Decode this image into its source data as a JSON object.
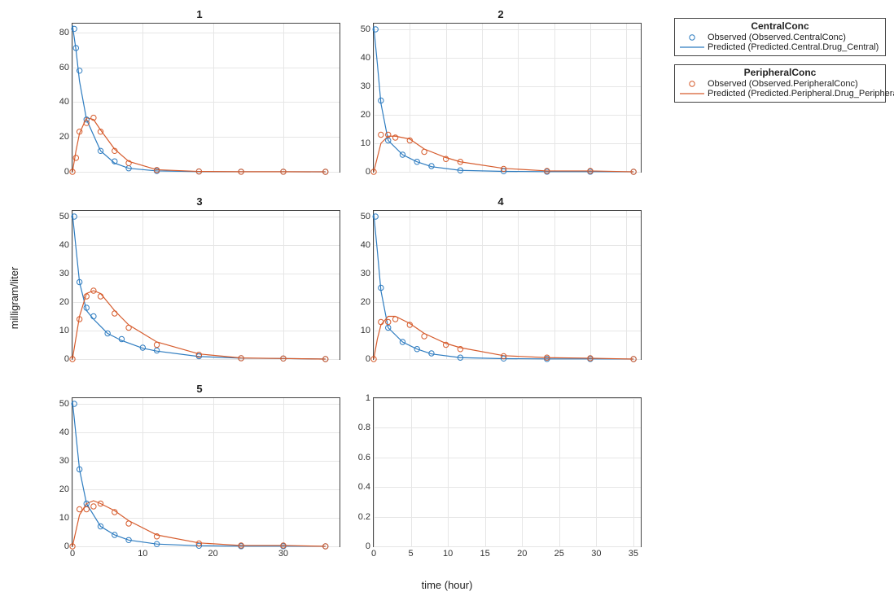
{
  "axis_labels": {
    "x": "time (hour)",
    "y": "milligram/liter"
  },
  "legend": {
    "central": {
      "title": "CentralConc",
      "observed": "Observed (Observed.CentralConc)",
      "predicted": "Predicted (Predicted.Central.Drug_Central)"
    },
    "peripheral": {
      "title": "PeripheralConc",
      "observed": "Observed (Observed.PeripheralConc)",
      "predicted": "Predicted (Predicted.Peripheral.Drug_Peripheral)"
    }
  },
  "chart_data": [
    {
      "title": "1",
      "xticks": [
        0,
        10,
        20,
        30
      ],
      "xmax": 38,
      "yticks": [
        0,
        20,
        40,
        60,
        80
      ],
      "ymax": 85,
      "central_obs": [
        [
          0.25,
          82
        ],
        [
          0.5,
          71
        ],
        [
          1,
          58
        ],
        [
          2,
          30
        ],
        [
          4,
          12
        ],
        [
          6,
          6
        ],
        [
          8,
          2
        ],
        [
          12,
          0.5
        ],
        [
          18,
          0.2
        ],
        [
          24,
          0.05
        ],
        [
          30,
          0.05
        ],
        [
          36,
          0
        ]
      ],
      "peripheral_obs": [
        [
          0,
          0
        ],
        [
          0.5,
          8
        ],
        [
          1,
          23
        ],
        [
          2,
          28
        ],
        [
          3,
          31
        ],
        [
          4,
          23
        ],
        [
          6,
          12
        ],
        [
          8,
          5
        ],
        [
          12,
          1
        ],
        [
          18,
          0.2
        ],
        [
          24,
          0.05
        ],
        [
          30,
          0.05
        ],
        [
          36,
          0
        ]
      ],
      "central_pred": [
        [
          0,
          84
        ],
        [
          0.5,
          70
        ],
        [
          1,
          52
        ],
        [
          2,
          30
        ],
        [
          4,
          12
        ],
        [
          6,
          5
        ],
        [
          8,
          2
        ],
        [
          12,
          0.5
        ],
        [
          18,
          0.1
        ],
        [
          24,
          0.03
        ],
        [
          30,
          0.02
        ],
        [
          36,
          0
        ]
      ],
      "peripheral_pred": [
        [
          0,
          0
        ],
        [
          0.5,
          12
        ],
        [
          1,
          22
        ],
        [
          2,
          31
        ],
        [
          3,
          30
        ],
        [
          4,
          24
        ],
        [
          6,
          13
        ],
        [
          8,
          6
        ],
        [
          12,
          1.2
        ],
        [
          18,
          0.2
        ],
        [
          24,
          0.05
        ],
        [
          30,
          0.05
        ],
        [
          36,
          0
        ]
      ]
    },
    {
      "title": "2",
      "xticks": [
        0,
        5,
        10,
        15,
        20,
        25,
        30,
        35
      ],
      "xmax": 37,
      "yticks": [
        0,
        10,
        20,
        30,
        40,
        50
      ],
      "ymax": 52,
      "central_obs": [
        [
          0.25,
          50
        ],
        [
          1,
          25
        ],
        [
          2,
          11
        ],
        [
          4,
          6
        ],
        [
          6,
          3.5
        ],
        [
          8,
          2
        ],
        [
          12,
          0.5
        ],
        [
          18,
          0.2
        ],
        [
          24,
          0.05
        ],
        [
          30,
          0.05
        ],
        [
          36,
          0
        ]
      ],
      "peripheral_obs": [
        [
          0,
          0
        ],
        [
          1,
          13
        ],
        [
          2,
          13
        ],
        [
          3,
          12
        ],
        [
          5,
          11
        ],
        [
          7,
          7
        ],
        [
          10,
          4.5
        ],
        [
          12,
          3.5
        ],
        [
          18,
          1
        ],
        [
          24,
          0.3
        ],
        [
          30,
          0.3
        ],
        [
          36,
          0
        ]
      ],
      "central_pred": [
        [
          0,
          51
        ],
        [
          0.5,
          38
        ],
        [
          1,
          24
        ],
        [
          2,
          11
        ],
        [
          4,
          6
        ],
        [
          6,
          3.5
        ],
        [
          8,
          1.8
        ],
        [
          12,
          0.5
        ],
        [
          18,
          0.15
        ],
        [
          24,
          0.05
        ],
        [
          30,
          0.05
        ],
        [
          36,
          0
        ]
      ],
      "peripheral_pred": [
        [
          0,
          0
        ],
        [
          0.5,
          5
        ],
        [
          1,
          10
        ],
        [
          2,
          12.5
        ],
        [
          3,
          12.5
        ],
        [
          5,
          11.5
        ],
        [
          7,
          8
        ],
        [
          10,
          5
        ],
        [
          12,
          3.5
        ],
        [
          18,
          1.2
        ],
        [
          24,
          0.3
        ],
        [
          30,
          0.3
        ],
        [
          36,
          0
        ]
      ]
    },
    {
      "title": "3",
      "xticks": [
        0,
        10,
        20,
        30
      ],
      "xmax": 38,
      "yticks": [
        0,
        10,
        20,
        30,
        40,
        50
      ],
      "ymax": 52,
      "central_obs": [
        [
          0.25,
          50
        ],
        [
          1,
          27
        ],
        [
          2,
          18
        ],
        [
          3,
          15
        ],
        [
          5,
          9
        ],
        [
          7,
          7
        ],
        [
          10,
          4
        ],
        [
          12,
          3
        ],
        [
          18,
          1
        ],
        [
          24,
          0.3
        ],
        [
          30,
          0.2
        ],
        [
          36,
          0
        ]
      ],
      "peripheral_obs": [
        [
          0,
          0
        ],
        [
          1,
          14
        ],
        [
          2,
          22
        ],
        [
          3,
          24
        ],
        [
          4,
          22
        ],
        [
          6,
          16
        ],
        [
          8,
          11
        ],
        [
          12,
          5
        ],
        [
          18,
          1.5
        ],
        [
          24,
          0.3
        ],
        [
          30,
          0.2
        ],
        [
          36,
          0
        ]
      ],
      "central_pred": [
        [
          0,
          51
        ],
        [
          1,
          27
        ],
        [
          2,
          17
        ],
        [
          3,
          14
        ],
        [
          5,
          9
        ],
        [
          7,
          6.5
        ],
        [
          10,
          3.8
        ],
        [
          12,
          2.8
        ],
        [
          18,
          0.9
        ],
        [
          24,
          0.3
        ],
        [
          30,
          0.2
        ],
        [
          36,
          0
        ]
      ],
      "peripheral_pred": [
        [
          0,
          0
        ],
        [
          1,
          15
        ],
        [
          2,
          23
        ],
        [
          3,
          24
        ],
        [
          4,
          23
        ],
        [
          6,
          17
        ],
        [
          8,
          12
        ],
        [
          12,
          6
        ],
        [
          18,
          1.8
        ],
        [
          24,
          0.4
        ],
        [
          30,
          0.2
        ],
        [
          36,
          0
        ]
      ]
    },
    {
      "title": "4",
      "xticks": [
        0,
        5,
        10,
        15,
        20,
        25,
        30,
        35
      ],
      "xmax": 37,
      "yticks": [
        0,
        10,
        20,
        30,
        40,
        50
      ],
      "ymax": 52,
      "central_obs": [
        [
          0.25,
          50
        ],
        [
          1,
          25
        ],
        [
          2,
          11
        ],
        [
          4,
          6
        ],
        [
          6,
          3.5
        ],
        [
          8,
          2
        ],
        [
          12,
          0.5
        ],
        [
          18,
          0.2
        ],
        [
          24,
          0.05
        ],
        [
          30,
          0.05
        ],
        [
          36,
          0
        ]
      ],
      "peripheral_obs": [
        [
          0,
          0
        ],
        [
          1,
          13
        ],
        [
          2,
          13
        ],
        [
          3,
          14
        ],
        [
          5,
          12
        ],
        [
          7,
          8
        ],
        [
          10,
          5
        ],
        [
          12,
          3.5
        ],
        [
          18,
          1
        ],
        [
          24,
          0.5
        ],
        [
          30,
          0.3
        ],
        [
          36,
          0
        ]
      ],
      "central_pred": [
        [
          0,
          51
        ],
        [
          0.5,
          38
        ],
        [
          1,
          24
        ],
        [
          2,
          11
        ],
        [
          4,
          6
        ],
        [
          6,
          3.5
        ],
        [
          8,
          1.8
        ],
        [
          12,
          0.5
        ],
        [
          18,
          0.15
        ],
        [
          24,
          0.05
        ],
        [
          30,
          0.05
        ],
        [
          36,
          0
        ]
      ],
      "peripheral_pred": [
        [
          0,
          0
        ],
        [
          0.5,
          7
        ],
        [
          1,
          12
        ],
        [
          2,
          15
        ],
        [
          3,
          15
        ],
        [
          5,
          12.5
        ],
        [
          7,
          9
        ],
        [
          10,
          5.5
        ],
        [
          12,
          4
        ],
        [
          18,
          1.2
        ],
        [
          24,
          0.5
        ],
        [
          30,
          0.3
        ],
        [
          36,
          0
        ]
      ]
    },
    {
      "title": "5",
      "xticks": [
        0,
        10,
        20,
        30
      ],
      "xmax": 38,
      "yticks": [
        0,
        10,
        20,
        30,
        40,
        50
      ],
      "ymax": 52,
      "central_obs": [
        [
          0.25,
          50
        ],
        [
          1,
          27
        ],
        [
          2,
          15
        ],
        [
          4,
          7
        ],
        [
          6,
          4
        ],
        [
          8,
          2.2
        ],
        [
          12,
          0.8
        ],
        [
          18,
          0.2
        ],
        [
          24,
          0.05
        ],
        [
          30,
          0.05
        ],
        [
          36,
          0
        ]
      ],
      "peripheral_obs": [
        [
          0,
          0
        ],
        [
          1,
          13
        ],
        [
          2,
          13
        ],
        [
          3,
          14
        ],
        [
          4,
          15
        ],
        [
          6,
          12
        ],
        [
          8,
          8
        ],
        [
          12,
          3.5
        ],
        [
          18,
          1
        ],
        [
          24,
          0.3
        ],
        [
          30,
          0.3
        ],
        [
          36,
          0
        ]
      ],
      "central_pred": [
        [
          0,
          51
        ],
        [
          1,
          27
        ],
        [
          2,
          15
        ],
        [
          4,
          7
        ],
        [
          6,
          4
        ],
        [
          8,
          2.2
        ],
        [
          12,
          0.8
        ],
        [
          18,
          0.2
        ],
        [
          24,
          0.05
        ],
        [
          30,
          0.05
        ],
        [
          36,
          0
        ]
      ],
      "peripheral_pred": [
        [
          0,
          0
        ],
        [
          1,
          11
        ],
        [
          2,
          15
        ],
        [
          3,
          16
        ],
        [
          4,
          15
        ],
        [
          6,
          12.5
        ],
        [
          8,
          9
        ],
        [
          12,
          4
        ],
        [
          18,
          1.2
        ],
        [
          24,
          0.3
        ],
        [
          30,
          0.3
        ],
        [
          36,
          0
        ]
      ]
    },
    {
      "title": "",
      "empty": true,
      "xticks": [
        0,
        5,
        10,
        15,
        20,
        25,
        30,
        35
      ],
      "xmax": 36,
      "yticks": [
        0,
        0.2,
        0.4,
        0.6,
        0.8,
        1
      ],
      "ymax": 1
    }
  ]
}
